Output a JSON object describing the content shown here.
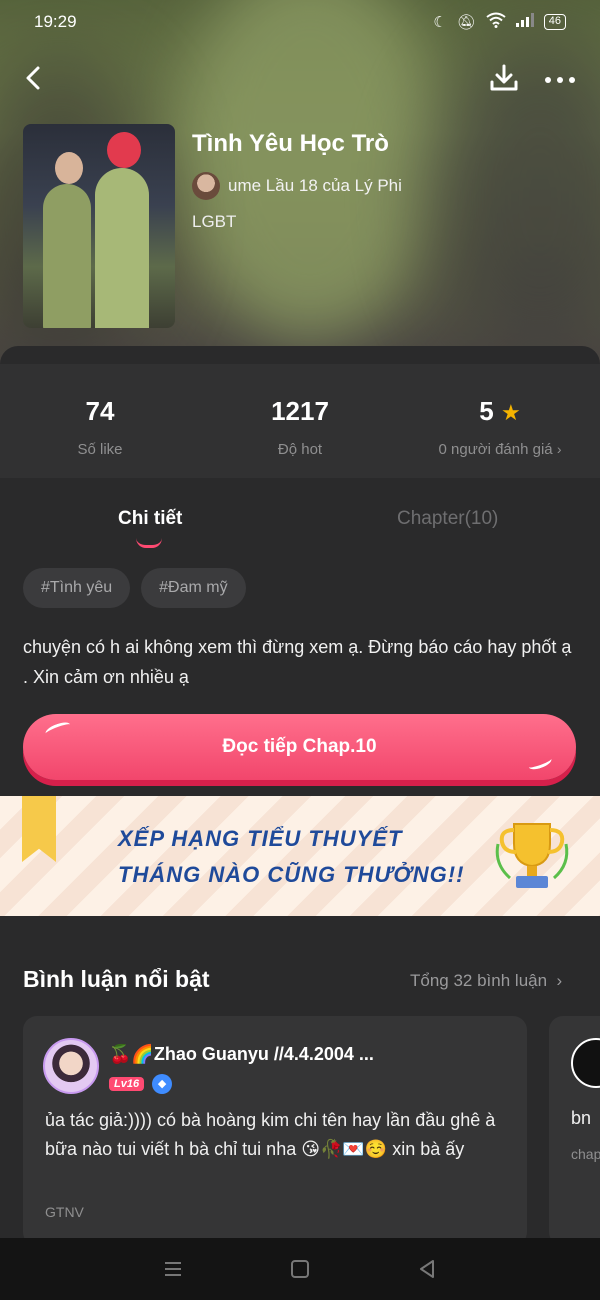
{
  "status_bar": {
    "time": "19:29",
    "battery": "46"
  },
  "book": {
    "title": "Tình Yêu Học Trò",
    "author": "ume Lầu 18 của Lý Phi",
    "genre": "LGBT"
  },
  "stats": [
    {
      "value": "74",
      "label": "Số like"
    },
    {
      "value": "1217",
      "label": "Độ hot"
    },
    {
      "value": "5",
      "label": "0 người đánh giá"
    }
  ],
  "tabs": [
    {
      "label": "Chi tiết",
      "active": true
    },
    {
      "label": "Chapter(10)",
      "active": false
    }
  ],
  "tags": [
    "#Tình yêu",
    "#Đam mỹ"
  ],
  "description": "chuyện có h ai không xem thì đừng xem ạ. Đừng báo cáo hay phốt ạ . Xin cảm ơn nhiều ạ",
  "read_button": "Đọc tiếp Chap.10",
  "banner": {
    "line1": "XẾP HẠNG TIỂU THUYẾT",
    "line2": "THÁNG NÀO CŨNG THƯỞNG!!"
  },
  "comments_section": {
    "title": "Bình luận nổi bật",
    "total": "Tổng 32 bình luận"
  },
  "comments": [
    {
      "name": "🍒🌈Zhao Guanyu //4.4.2004 ...",
      "level": "Lv16",
      "text": "ủa tác giả:)))) có bà hoàng kim chi tên hay lần đầu ghê à bữa nào tui viết h bà chỉ tui nha 😘🥀💌☺️ xin bà ấy",
      "meta": "GTNV"
    },
    {
      "text": "bn",
      "meta": "chap"
    }
  ],
  "colors": {
    "accent": "#ff4a72",
    "background": "#2a2a2b",
    "star": "#f5b400"
  }
}
